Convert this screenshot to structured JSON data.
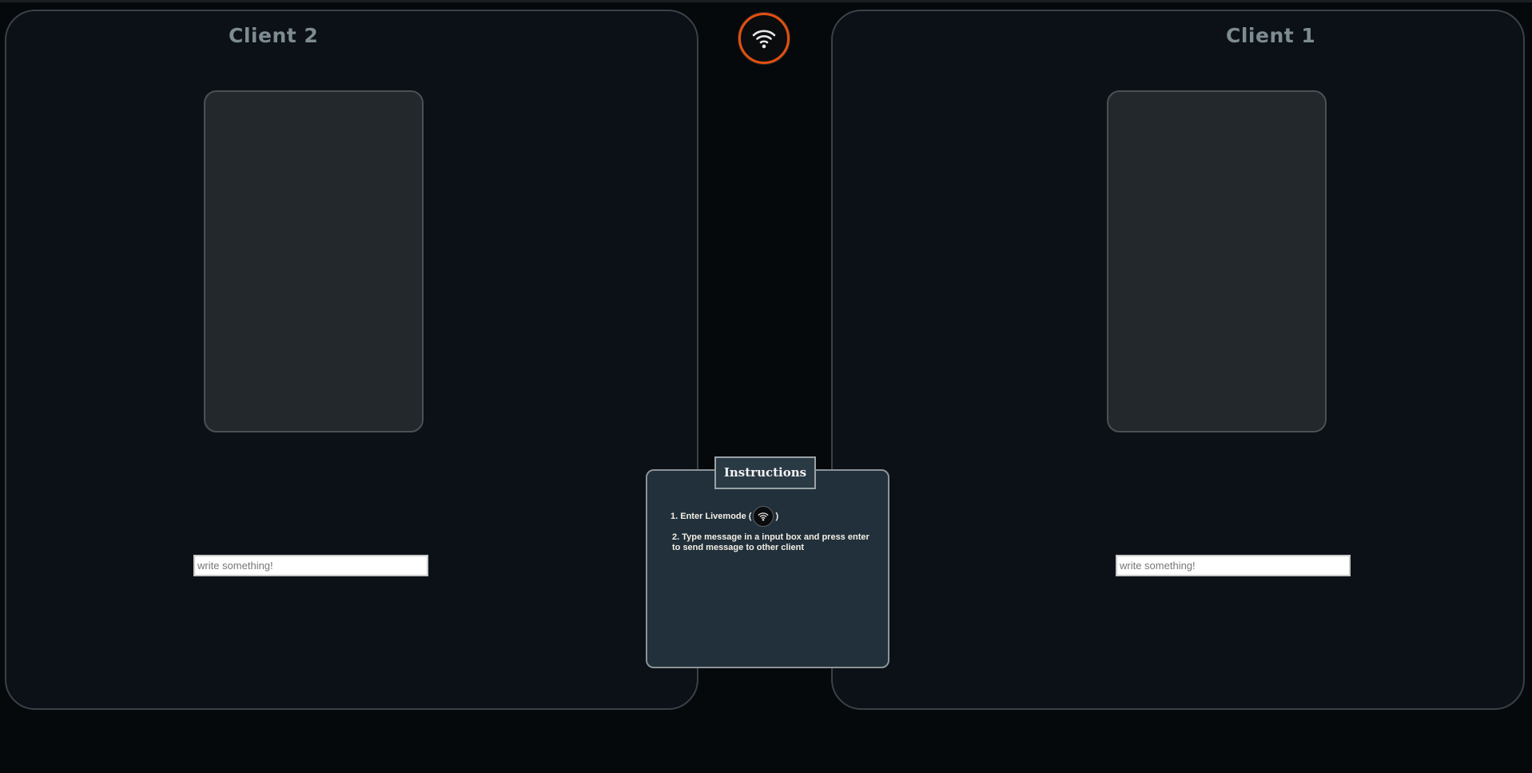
{
  "live_button": {
    "icon": "wifi-icon",
    "ring_color": "#e2500f"
  },
  "clients": [
    {
      "title": "Client 2",
      "input_placeholder": "write something!"
    },
    {
      "title": "Client 1",
      "input_placeholder": "write something!"
    }
  ],
  "instructions": {
    "title": "Instructions",
    "step1_prefix": "1. Enter Livemode (",
    "step1_suffix": ")",
    "step2": "2. Type message in a input box and press enter to send message to other client"
  }
}
